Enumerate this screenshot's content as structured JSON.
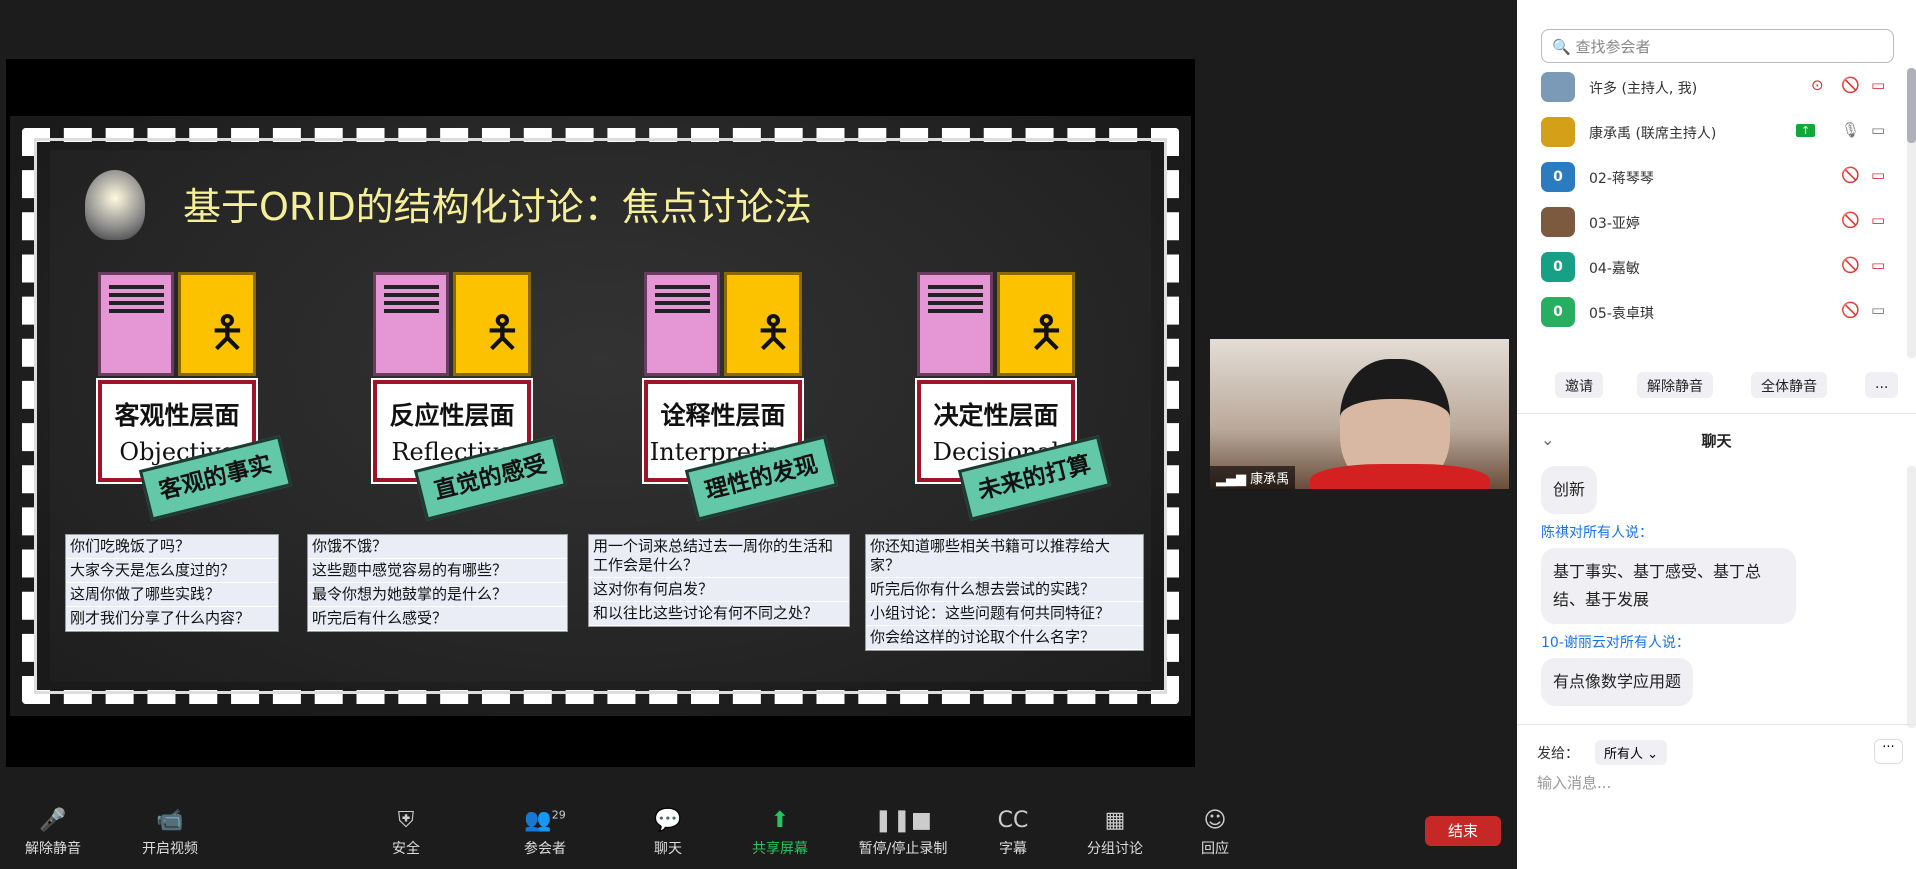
{
  "slide": {
    "title": "基于ORID的结构化讨论：焦点讨论法",
    "columns": [
      {
        "zh": "客观性层面",
        "en": "Objective",
        "tag": "客观的事实",
        "questions": [
          "你们吃晚饭了吗？",
          "大家今天是怎么度过的？",
          "这周你做了哪些实践？",
          "刚才我们分享了什么内容？"
        ]
      },
      {
        "zh": "反应性层面",
        "en": "Reflective",
        "tag": "直觉的感受",
        "questions": [
          "你饿不饿？",
          "这些题中感觉容易的有哪些？",
          "最令你想为她鼓掌的是什么？",
          "听完后有什么感受？"
        ]
      },
      {
        "zh": "诠释性层面",
        "en": "Interpretive",
        "tag": "理性的发现",
        "questions": [
          "用一个词来总结过去一周你的生活和工作会是什么？",
          "这对你有何启发？",
          "和以往比这些讨论有何不同之处？"
        ]
      },
      {
        "zh": "决定性层面",
        "en": "Decisional",
        "tag": "未来的打算",
        "questions": [
          "你还知道哪些相关书籍可以推荐给大家？",
          "听完后你有什么想去尝试的实践？",
          "小组讨论：这些问题有何共同特征？",
          "你会给这样的讨论取个什么名字？"
        ]
      }
    ]
  },
  "video": {
    "name": "康承禹"
  },
  "participants": {
    "search_placeholder": "查找参会者",
    "list": [
      {
        "name": "许多 (主持人, 我)",
        "avatar": "",
        "color": "#7a9ab8"
      },
      {
        "name": "康承禹 (联席主持人)",
        "avatar": "",
        "color": "#d4a017"
      },
      {
        "name": "02-蒋琴琴",
        "avatar": "0",
        "color": "#2a7bbf"
      },
      {
        "name": "03-亚婷",
        "avatar": "",
        "color": "#7b5a40"
      },
      {
        "name": "04-嘉敏",
        "avatar": "0",
        "color": "#17a085"
      },
      {
        "name": "05-袁卓琪",
        "avatar": "0",
        "color": "#27ae60"
      }
    ],
    "buttons": {
      "invite": "邀请",
      "unmute": "解除静音",
      "mute_all": "全体静音",
      "more": "..."
    }
  },
  "chat": {
    "title": "聊天",
    "messages": [
      {
        "sender": "",
        "text": "创新"
      },
      {
        "sender": "陈祺对所有人说：",
        "text": "基丁事实、基丁感受、基丁总结、基于发展"
      },
      {
        "sender": "10-谢丽云对所有人说：",
        "text": "有点像数学应用题"
      }
    ],
    "send_to_label": "发给：",
    "send_to_value": "所有人",
    "input_placeholder": "输入消息..."
  },
  "toolbar": {
    "items": [
      {
        "label": "解除静音",
        "icon": "mic-muted-icon"
      },
      {
        "label": "开启视频",
        "icon": "video-off-icon"
      },
      {
        "label": "安全",
        "icon": "shield-icon"
      },
      {
        "label": "参会者",
        "icon": "participants-icon",
        "count": "29"
      },
      {
        "label": "聊天",
        "icon": "chat-icon"
      },
      {
        "label": "共享屏幕",
        "icon": "share-screen-icon"
      },
      {
        "label": "暂停/停止录制",
        "icon": "record-icon"
      },
      {
        "label": "字幕",
        "icon": "cc-icon"
      },
      {
        "label": "分组讨论",
        "icon": "breakout-icon"
      },
      {
        "label": "回应",
        "icon": "reaction-icon"
      }
    ],
    "end": "结束",
    "share_color": "#22c55e",
    "end_color": "#c62828"
  }
}
